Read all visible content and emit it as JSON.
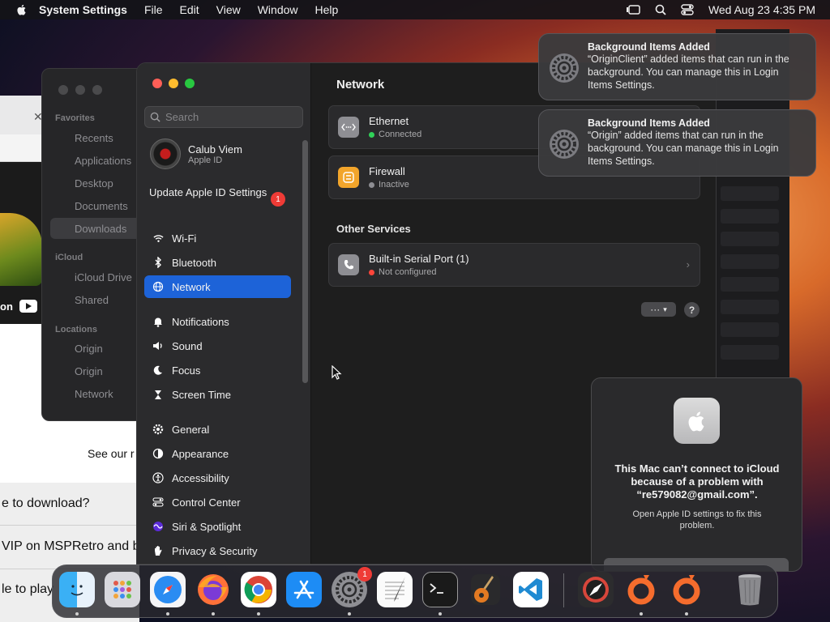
{
  "menubar": {
    "app_name": "System Settings",
    "menus": [
      "File",
      "Edit",
      "View",
      "Window",
      "Help"
    ],
    "clock": "Wed Aug 23  4:35 PM"
  },
  "browser": {
    "on_text": "on",
    "see_our": "See our r",
    "line1": "e to download?",
    "line2": "VIP on MSPRetro and b",
    "line3": "le to play"
  },
  "finder": {
    "favorites_header": "Favorites",
    "favorites": [
      "Recents",
      "Applications",
      "Desktop",
      "Documents",
      "Downloads"
    ],
    "icloud_header": "iCloud",
    "icloud": [
      "iCloud Drive",
      "Shared"
    ],
    "locations_header": "Locations",
    "locations": [
      "Origin",
      "Origin",
      "Network"
    ]
  },
  "settings": {
    "search_placeholder": "Search",
    "profile_name": "Calub Viem",
    "profile_sub": "Apple ID",
    "update_label": "Update Apple ID Settings",
    "update_badge": "1",
    "nav": [
      {
        "label": "Wi-Fi",
        "color": "#1a7cf5"
      },
      {
        "label": "Bluetooth",
        "color": "#1a7cf5"
      },
      {
        "label": "Network",
        "color": "#1a7cf5"
      },
      {
        "label": "Notifications",
        "color": "#ef3b36"
      },
      {
        "label": "Sound",
        "color": "#ef3b58"
      },
      {
        "label": "Focus",
        "color": "#5b4bdb"
      },
      {
        "label": "Screen Time",
        "color": "#5b4bdb"
      },
      {
        "label": "General",
        "color": "#8e8e93"
      },
      {
        "label": "Appearance",
        "color": "#1c1c1e"
      },
      {
        "label": "Accessibility",
        "color": "#1a7cf5"
      },
      {
        "label": "Control Center",
        "color": "#8e8e93"
      },
      {
        "label": "Siri & Spotlight",
        "color": "#c43fd2"
      },
      {
        "label": "Privacy & Security",
        "color": "#1a7cf5"
      }
    ],
    "title": "Network",
    "services": [
      {
        "name": "Ethernet",
        "status": "Connected",
        "status_color": "#30d158"
      },
      {
        "name": "Firewall",
        "status": "Inactive",
        "status_color": "#8e8e93"
      }
    ],
    "other_header": "Other Services",
    "other": [
      {
        "name": "Built-in Serial Port (1)",
        "status": "Not configured",
        "status_color": "#ff453a"
      }
    ],
    "action_label": "···",
    "help_label": "?"
  },
  "notifications": [
    {
      "title": "Background Items Added",
      "body": "“OriginClient” added items that can run in the background. You can manage this in Login Items Settings."
    },
    {
      "title": "Background Items Added",
      "body": "“Origin” added items that can run in the background. You can manage this in Login Items Settings."
    }
  ],
  "alert": {
    "title": "This Mac can’t connect to iCloud because of a problem with “re579082@gmail.com”.",
    "body": "Open Apple ID settings to fix this problem."
  },
  "dock": {
    "items": [
      "Finder",
      "Launchpad",
      "Safari",
      "Firefox",
      "Chrome",
      "App Store",
      "System Settings",
      "TextEdit",
      "Terminal",
      "GarageBand",
      "VS Code",
      "Compass",
      "Origin",
      "Origin",
      "Trash"
    ],
    "settings_badge": "1"
  }
}
